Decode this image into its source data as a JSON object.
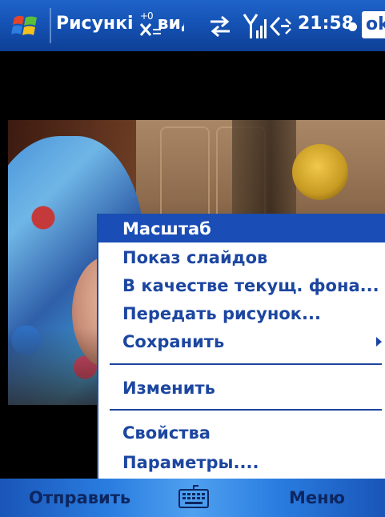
{
  "status_bar": {
    "title": "Рисункі",
    "title_tail": "вид",
    "clock": "21:58",
    "ok_label": "ok",
    "icons": [
      "windows-start-icon",
      "connectivity-icon",
      "signal-icon",
      "volume-icon"
    ]
  },
  "menu": {
    "items": [
      {
        "label": "Масштаб",
        "selected": true
      },
      {
        "label": "Показ слайдов"
      },
      {
        "label": "В качестве текущ. фона..."
      },
      {
        "label": "Передать рисунок..."
      },
      {
        "label": "Сохранить",
        "submenu": true
      },
      {
        "label": "Изменить"
      },
      {
        "label": "Свойства"
      },
      {
        "label": "Параметры...."
      }
    ]
  },
  "softkeys": {
    "left": "Отправить",
    "right": "Меню",
    "center_icon": "keyboard-icon"
  },
  "colors": {
    "titlebar": "#1553b5",
    "menu_text": "#1c46a0",
    "menu_selected_bg": "#1a4db6",
    "softkey_text": "#0d2660"
  }
}
